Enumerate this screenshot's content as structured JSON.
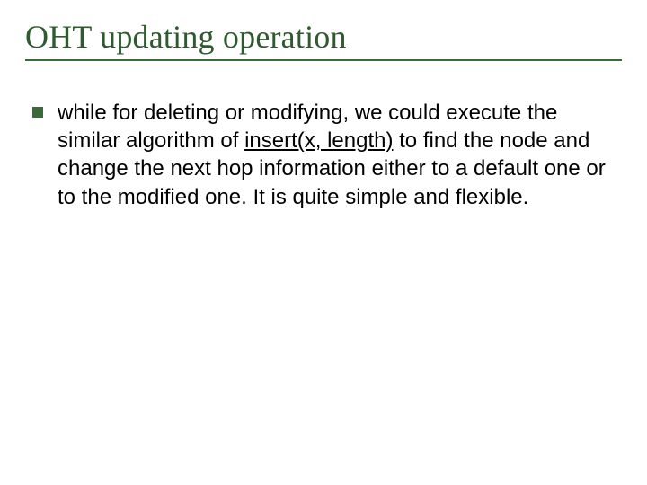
{
  "title": "OHT updating operation",
  "body": {
    "pre": "while for deleting or modifying, we could execute the similar algorithm of ",
    "func": "insert(x, length)",
    "post": " to find the node and change the next hop information either to a default one or to the modified one. It is quite simple and flexible."
  }
}
